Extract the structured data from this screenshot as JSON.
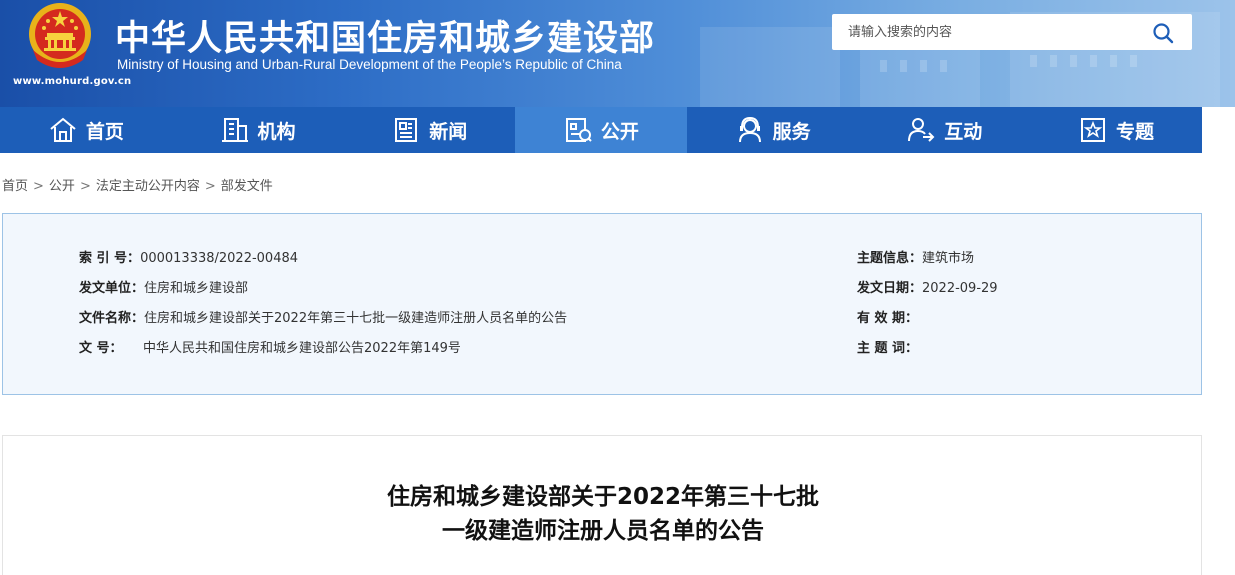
{
  "header": {
    "title": "中华人民共和国住房和城乡建设部",
    "subtitle": "Ministry of Housing and Urban-Rural Development of the People’s Republic of China",
    "url": "www.mohurd.gov.cn",
    "emblem_icon": "national-emblem-icon"
  },
  "search": {
    "placeholder": "请输入搜索的内容",
    "value": "",
    "icon": "search-icon"
  },
  "nav": {
    "items": [
      {
        "label": "首页",
        "icon": "home-icon",
        "active": false
      },
      {
        "label": "机构",
        "icon": "building-icon",
        "active": false
      },
      {
        "label": "新闻",
        "icon": "newspaper-icon",
        "active": false
      },
      {
        "label": "公开",
        "icon": "open-info-icon",
        "active": true
      },
      {
        "label": "服务",
        "icon": "service-icon",
        "active": false
      },
      {
        "label": "互动",
        "icon": "interaction-icon",
        "active": false
      },
      {
        "label": "专题",
        "icon": "special-topic-icon",
        "active": false
      }
    ]
  },
  "breadcrumb": {
    "items": [
      "首页",
      "公开",
      "法定主动公开内容",
      "部发文件"
    ],
    "separator": ">"
  },
  "info": {
    "index_label": "索 引 号：",
    "index_value": "000013338/2022-00484",
    "topic_label": "主题信息：",
    "topic_value": "建筑市场",
    "issuer_label": "发文单位：",
    "issuer_value": "住房和城乡建设部",
    "date_label": "发文日期：",
    "date_value": "2022-09-29",
    "filename_label": "文件名称：",
    "filename_value": "住房和城乡建设部关于2022年第三十七批一级建造师注册人员名单的公告",
    "validity_label": "有 效 期：",
    "validity_value": "",
    "docno_label": "文        号：",
    "docno_value": "中华人民共和国住房和城乡建设部公告2022年第149号",
    "keywords_label": "主 题 词：",
    "keywords_value": ""
  },
  "document": {
    "title_line1": "住房和城乡建设部关于2022年第三十七批",
    "title_line2": "一级建造师注册人员名单的公告"
  },
  "colors": {
    "nav_bg": "#1d5eb8",
    "nav_active": "#3e83d4",
    "info_bg": "#f2f7fd",
    "info_border": "#9dc3e6"
  }
}
